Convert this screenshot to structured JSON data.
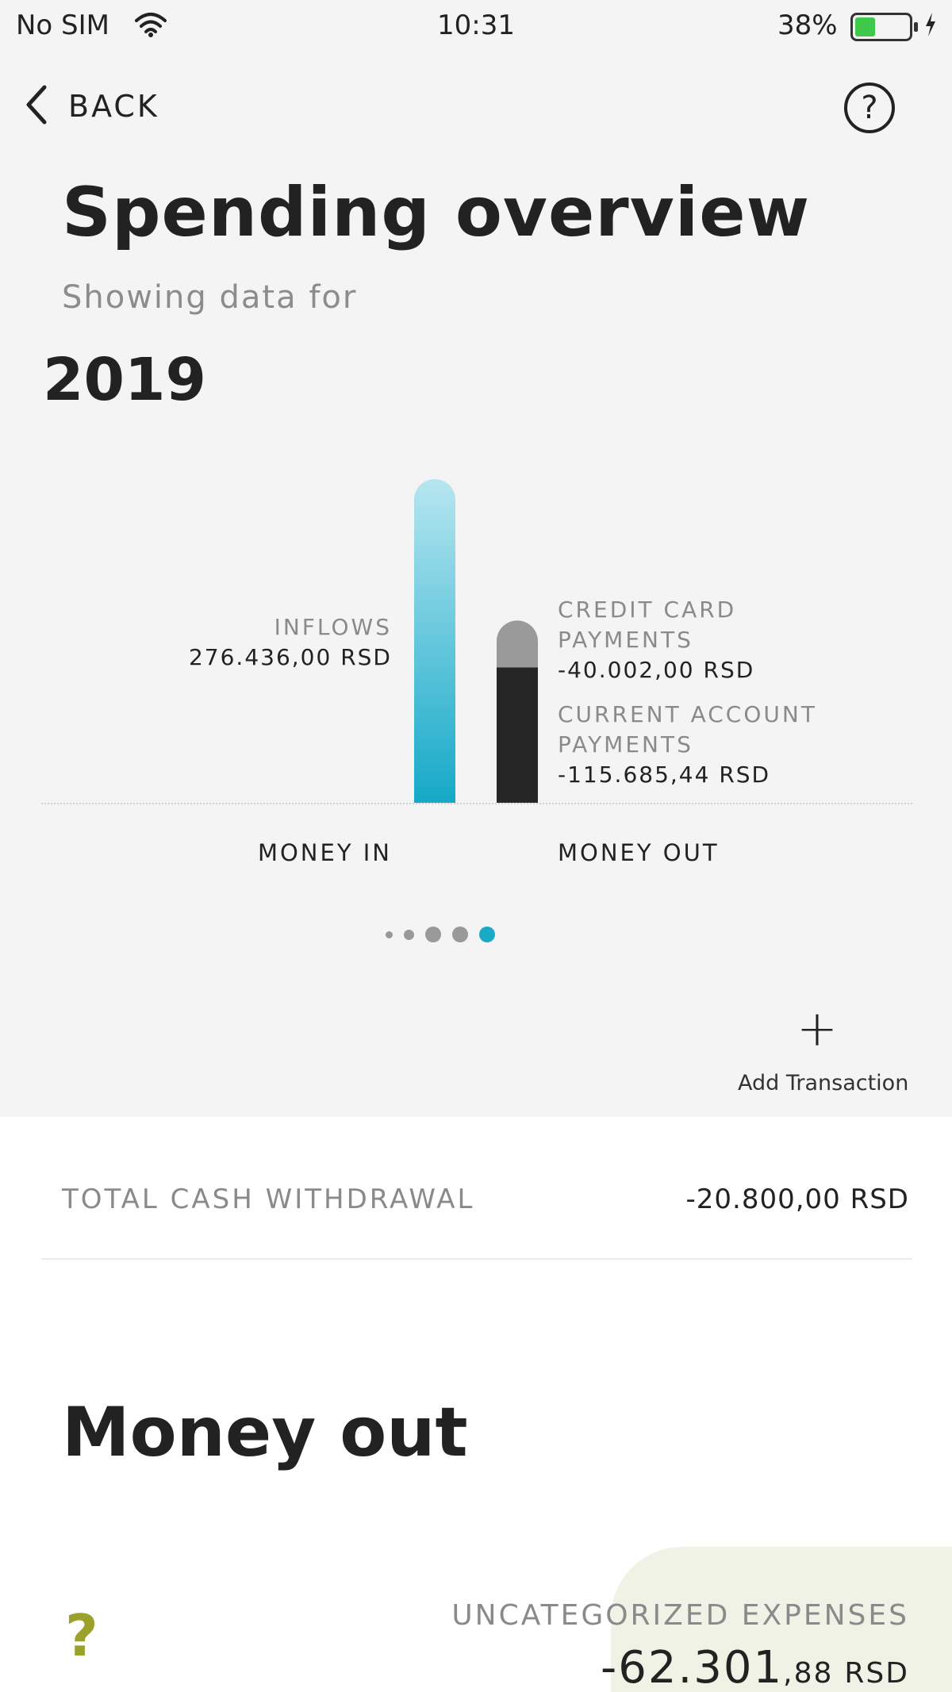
{
  "status_bar": {
    "carrier": "No SIM",
    "time": "10:31",
    "battery_percent": "38%",
    "battery_level": 0.38,
    "battery_color": "#3fc94a"
  },
  "nav": {
    "back_label": "BACK",
    "back_icon": "chevron-left-icon",
    "help_icon": "question-circle-icon",
    "help_glyph": "?"
  },
  "header": {
    "title": "Spending overview",
    "subtitle": "Showing data for",
    "period": "2019"
  },
  "chart_data": {
    "type": "bar",
    "categories": [
      "MONEY IN",
      "MONEY OUT"
    ],
    "series": [
      {
        "name": "INFLOWS",
        "category": "MONEY IN",
        "value": 276436.0,
        "display": "276.436,00 RSD",
        "color_top": "#b6e6f0",
        "color_bottom": "#15a9c8"
      },
      {
        "name": "CURRENT ACCOUNT PAYMENTS",
        "category": "MONEY OUT",
        "value": 115685.44,
        "display": "-115.685,44 RSD",
        "color": "#262626"
      },
      {
        "name": "CREDIT CARD PAYMENTS",
        "category": "MONEY OUT",
        "value": 40002.0,
        "display": "-40.002,00 RSD",
        "color": "#9a9a9a"
      }
    ],
    "stacked": true,
    "legend_labels": {
      "inflows": "INFLOWS",
      "credit_card": [
        "CREDIT CARD",
        "PAYMENTS"
      ],
      "current_account": [
        "CURRENT ACCOUNT",
        "PAYMENTS"
      ]
    },
    "grid": false
  },
  "pager": {
    "count": 5,
    "active_index": 4,
    "active_color": "#1ba9c8"
  },
  "actions": {
    "add_icon": "plus-icon",
    "add_glyph": "+",
    "add_label": "Add Transaction"
  },
  "summary": {
    "cash_withdrawal_label": "TOTAL CASH WITHDRAWAL",
    "cash_withdrawal_value": "-20.800,00 RSD"
  },
  "money_out": {
    "title": "Money out",
    "uncategorized": {
      "icon": "question-mark-icon",
      "glyph": "?",
      "label": "UNCATEGORIZED EXPENSES",
      "amount_main": "-62.301",
      "amount_decimals": ",88",
      "currency": "RSD",
      "icon_color": "#9aa22c"
    }
  }
}
